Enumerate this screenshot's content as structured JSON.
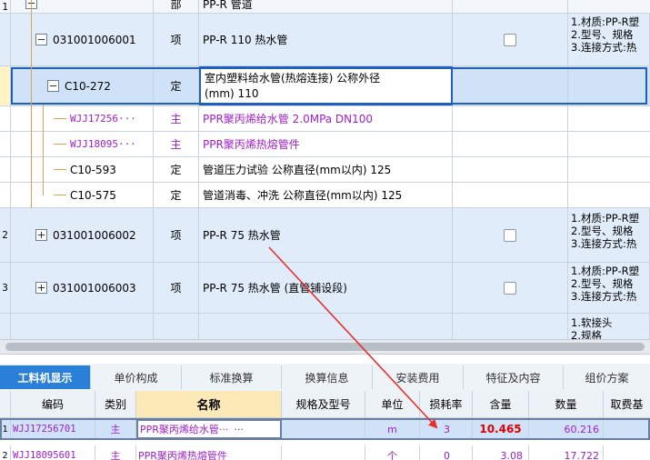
{
  "upper_table": {
    "rows": [
      {
        "idx": "1",
        "code": "",
        "type": "部",
        "name": "PP-R 管道",
        "feature": ""
      },
      {
        "idx": "",
        "code": "031001006001",
        "type": "项",
        "name": "PP-R 110 热水管",
        "feature1": "1.材质:PP-R塑",
        "feature2": "2.型号、规格",
        "feature3": "3.连接方式:热"
      },
      {
        "idx": "",
        "code": "C10-272",
        "type": "定",
        "name1": "室内塑料给水管(热熔连接) 公称外径",
        "name2": "(mm) 110"
      },
      {
        "idx": "",
        "code": "WJJ17256···",
        "type": "主",
        "name": "PPR聚丙烯给水管 2.0MPa DN100"
      },
      {
        "idx": "",
        "code": "WJJ18095···",
        "type": "主",
        "name": "PPR聚丙烯热熔管件"
      },
      {
        "idx": "",
        "code": "C10-593",
        "type": "定",
        "name": "管道压力试验 公称直径(mm以内) 125"
      },
      {
        "idx": "",
        "code": "C10-575",
        "type": "定",
        "name": "管道消毒、冲洗 公称直径(mm以内) 125"
      },
      {
        "idx": "2",
        "code": "031001006002",
        "type": "项",
        "name": "PP-R 75 热水管",
        "feature1": "1.材质:PP-R塑",
        "feature2": "2.型号、规格",
        "feature3": "3.连接方式:热"
      },
      {
        "idx": "3",
        "code": "031001006003",
        "type": "项",
        "name": "PP-R 75 热水管 (直管铺设段)",
        "feature1": "1.材质:PP-R塑",
        "feature2": "2.型号、规格",
        "feature3": "3.连接方式:热"
      },
      {
        "idx": "",
        "code": "",
        "type": "",
        "name": "",
        "feature1": "1.软接头",
        "feature2": "2.规格"
      }
    ]
  },
  "tabs": [
    "工料机显示",
    "单价构成",
    "标准换算",
    "换算信息",
    "安装费用",
    "特征及内容",
    "组价方案"
  ],
  "lower_table": {
    "headers": [
      "编码",
      "类别",
      "名称",
      "规格及型号",
      "单位",
      "损耗率",
      "含量",
      "数量",
      "取费基"
    ],
    "rows": [
      {
        "idx": "1",
        "code": "WJJ17256701",
        "type": "主",
        "name": "PPR聚丙烯给水管···",
        "spec": "",
        "unit": "m",
        "loss": "3",
        "content": "10.465",
        "qty": "60.216"
      },
      {
        "idx": "2",
        "code": "WJJ18095601",
        "type": "主",
        "name": "PPR聚丙烯热熔管件",
        "spec": "",
        "unit": "个",
        "loss": "0",
        "content": "3.08",
        "qty": "17.722"
      }
    ]
  },
  "ellipsis": "···",
  "colors": {
    "selected_border": "#1f5fbf",
    "purple_text": "#a020c8",
    "red_value": "#e00000",
    "arrow": "#e53030",
    "active_tab": "#2a7fd6"
  }
}
